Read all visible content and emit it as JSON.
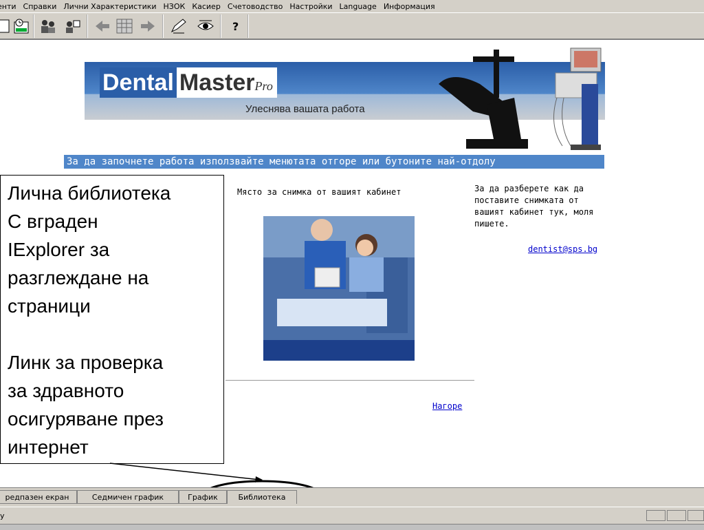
{
  "menubar": {
    "items": [
      "енти",
      "Справки",
      "Лични Характеристики",
      "НЗОК",
      "Касиер",
      "Счетоводство",
      "Настройки",
      "Language",
      "Информация"
    ]
  },
  "banner": {
    "logo_word1": "Dental",
    "logo_word2": "Master",
    "logo_pro": "Pro",
    "slogan": "Улеснява вашата работа"
  },
  "info_strip": "За да започнете работа използвайте менютата отгоре или бутоните най-отдолу",
  "main": {
    "photo_label": "Място за снимка от вашият кабинет",
    "right_text": "За да разберете как да поставите снимката от вашият кабинет тук, моля пишете.",
    "email": "dentist@sps.bg",
    "top_link": "Нагоре"
  },
  "callout": {
    "paragraph1": [
      "Лична библиотека",
      "С вграден",
      "IExplorer за",
      "разглеждане на",
      "страници"
    ],
    "paragraph2": [
      "Линк за проверка",
      "за здравното",
      "осигуряване през",
      "интернет"
    ]
  },
  "tabs": [
    "редпазен екран",
    "Седмичен график",
    "График",
    "Библиотека"
  ],
  "status": {
    "text": "у"
  },
  "colors": {
    "banner_blue": "#2b5ea8",
    "strip_blue": "#4f86c9",
    "chrome": "#d4d0c8",
    "link": "#0000cc"
  }
}
